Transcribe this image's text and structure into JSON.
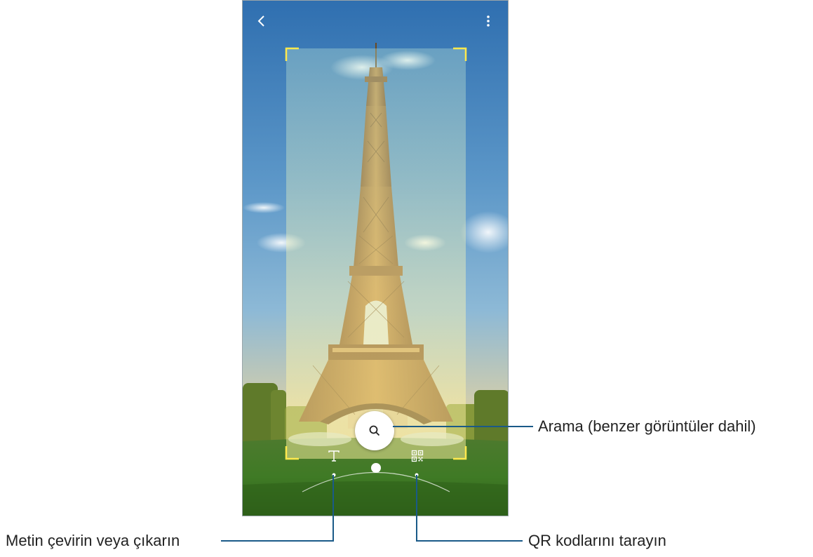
{
  "toolbar": {
    "back_icon": "chevron-left-icon",
    "more_icon": "more-vertical-icon"
  },
  "viewfinder": {
    "focus_frame_color": "#ffe94d"
  },
  "controls": {
    "search_icon": "search-icon",
    "text_mode_icon": "text-icon",
    "qr_mode_icon": "qr-code-icon"
  },
  "callouts": {
    "search": "Arama (benzer görüntüler dahil)",
    "text": "Metin çevirin veya çıkarın",
    "qr": "QR kodlarını tarayın"
  },
  "colors": {
    "leader_line": "#1a5a88",
    "shutter": "#ffffff"
  }
}
